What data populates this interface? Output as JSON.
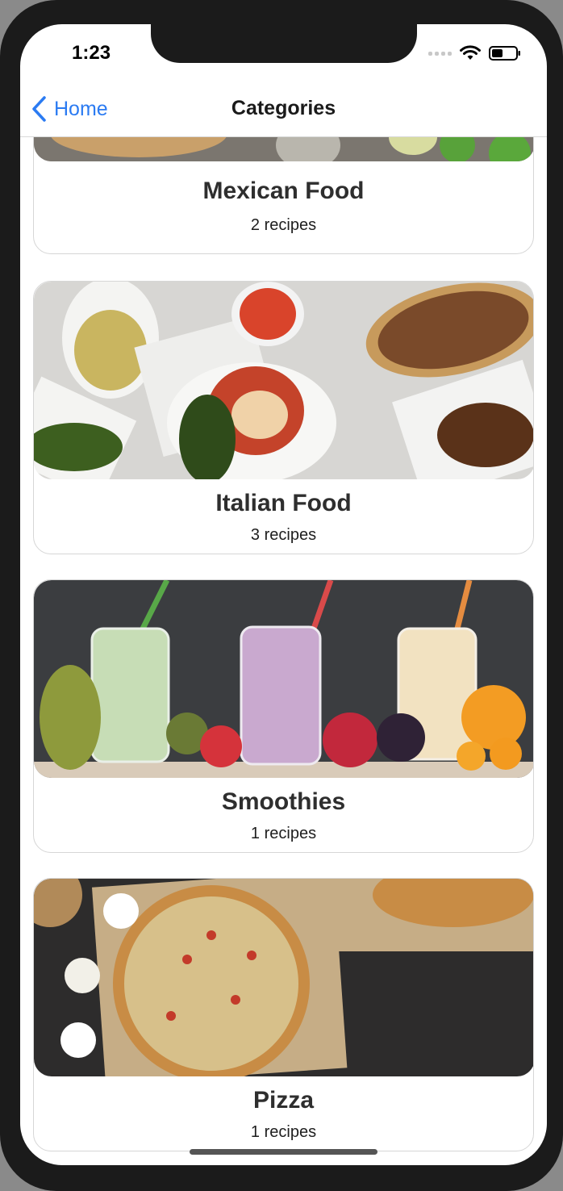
{
  "status_bar": {
    "time": "1:23"
  },
  "nav": {
    "back_label": "Home",
    "title": "Categories"
  },
  "categories": [
    {
      "name": "Mexican Food",
      "count": "2 recipes"
    },
    {
      "name": "Italian Food",
      "count": "3 recipes"
    },
    {
      "name": "Smoothies",
      "count": "1 recipes"
    },
    {
      "name": "Pizza",
      "count": "1 recipes"
    }
  ],
  "colors": {
    "accent": "#2b7bf2",
    "frame": "#1b1b1b"
  },
  "icons": [
    "chevron-left-icon",
    "wifi-icon",
    "battery-icon",
    "signal-icon"
  ]
}
